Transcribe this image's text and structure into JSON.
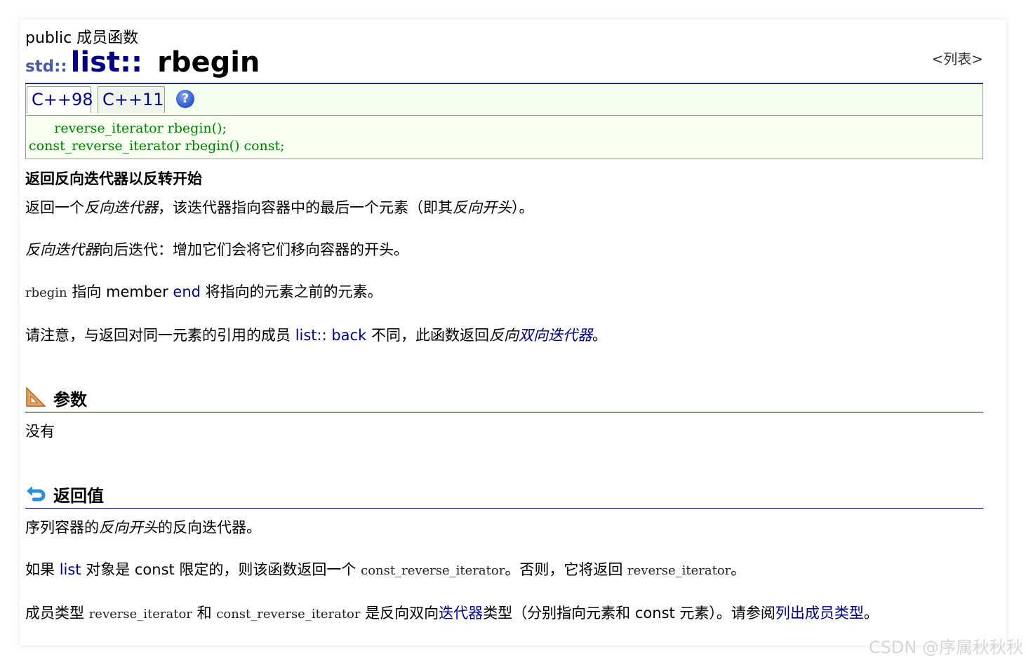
{
  "header": {
    "kind_label": "public 成员函数",
    "list_link": "<列表>",
    "title_ns": "std::",
    "title_class": "list",
    "title_sep": "::",
    "title_member": "rbegin"
  },
  "tabs": [
    {
      "label": "C++98"
    },
    {
      "label": "C++11"
    }
  ],
  "help_icon": "?",
  "code_lines": [
    "      reverse_iterator rbegin();",
    "const_reverse_iterator rbegin() const;"
  ],
  "summary_title": "返回反向迭代器以反转开始",
  "paragraphs": {
    "p1_a": "返回一个",
    "p1_em1": "反向迭代器",
    "p1_b": "，该迭代器指向容器中的最后一个元素（即其",
    "p1_em2": "反向开头",
    "p1_c": "）。",
    "p2_em": "反向迭代器",
    "p2_b": "向后迭代：增加它们会将它们移向容器的开头。",
    "p3_code": "rbegin",
    "p3_b": " 指向 member ",
    "p3_link": "end",
    "p3_c": " 将指向的元素之前的元素。",
    "p4_a": "请注意，与返回对同一元素的引用的成员 ",
    "p4_link": "list:: back",
    "p4_b": " 不同，此函数返回",
    "p4_em1": "反向",
    "p4_em_link": "双向迭代器",
    "p4_c": "。"
  },
  "params": {
    "heading": "参数",
    "text": "没有"
  },
  "return_value": {
    "heading": "返回值",
    "r1_a": "序列容器的",
    "r1_em": "反向开头",
    "r1_b": "的反向迭代器。",
    "r2_a": "如果 ",
    "r2_link": "list",
    "r2_b": " 对象是 const 限定的，则该函数返回一个 ",
    "r2_code1": "const_reverse_iterator",
    "r2_c": "。否则，它将返回 ",
    "r2_code2": "reverse_iterator",
    "r2_d": "。",
    "r3_a": "成员类型 ",
    "r3_code1": "reverse_iterator",
    "r3_b": " 和 ",
    "r3_code2": "const_reverse_iterator",
    "r3_c": " 是反向双向",
    "r3_link1": "迭代器",
    "r3_d": "类型（分别指向元素和 const 元素）。请参阅",
    "r3_link2": "列出成员类型",
    "r3_e": "。"
  },
  "watermark": "CSDN @序属秋秋秋",
  "colors": {
    "title_blue": "#000080",
    "code_green": "#008000",
    "tab_bg": "#f4ffee",
    "link": "#000080"
  }
}
